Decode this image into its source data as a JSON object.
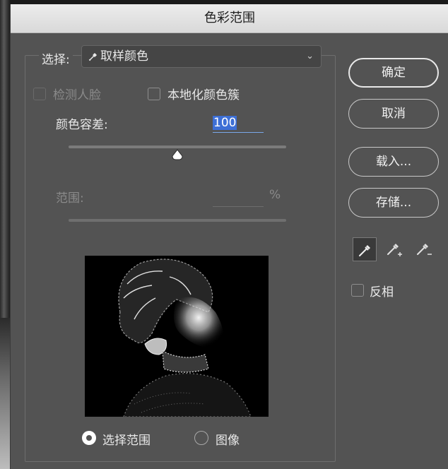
{
  "dialog": {
    "title": "色彩范围",
    "select": {
      "label": "选择:",
      "value": "取样颜色"
    },
    "detect_faces": {
      "label": "检测人脸",
      "checked": false,
      "enabled": false
    },
    "localized_clusters": {
      "label": "本地化颜色簇",
      "checked": false
    },
    "fuzziness": {
      "label": "颜色容差:",
      "value": "100",
      "slider_fraction": 0.5
    },
    "range": {
      "label": "范围:",
      "unit": "%",
      "enabled": false
    },
    "preview_modes": {
      "selection": "选择范围",
      "image": "图像",
      "selected": "selection"
    },
    "buttons": {
      "ok": "确定",
      "cancel": "取消",
      "load": "载入...",
      "save": "存储..."
    },
    "eyedropper_tools": [
      "eyedropper-icon",
      "eyedropper-plus-icon",
      "eyedropper-minus-icon"
    ],
    "invert": {
      "label": "反相",
      "checked": false
    },
    "colors": {
      "panel": "#535353",
      "titlebar": "#dcdcdc",
      "highlight": "#3d6fd6"
    }
  }
}
